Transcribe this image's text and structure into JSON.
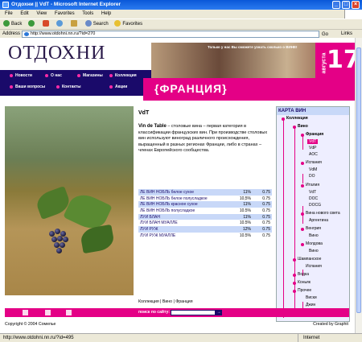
{
  "window": {
    "title": "Отдохни || VdT - Microsoft Internet Explorer"
  },
  "menu": [
    "File",
    "Edit",
    "View",
    "Favorites",
    "Tools",
    "Help"
  ],
  "toolbar": {
    "back": "Back",
    "search": "Search",
    "favorites": "Favorites"
  },
  "address": {
    "label": "Address",
    "url": "http://www.otdohni.nn.ru/?id=270",
    "go": "Go",
    "links": "Links"
  },
  "site": {
    "logo": "ОТДОХНИ",
    "banner_text": "Только у нас Вы сможете узнать сколько о ВИНЕ!",
    "date_day": "17",
    "date_month": "августа",
    "nav": [
      "Новости",
      "О нас",
      "Магазины",
      "Коллекция",
      "Ваши вопросы",
      "Контакты",
      "Акции"
    ],
    "section_title": "{ФРАНЦИЯ}"
  },
  "article": {
    "heading": "VdT",
    "lead_bold": "Vin de Table",
    "text": " – столовые вина – первая категория в классификации французских вин. При производстве столовых вин используют виноград различного происхождения, выращенный в разных регионах Франции, либо в странах – членах Европейского сообщества."
  },
  "wines": [
    {
      "name": "ЛЕ ВИН НОБЛЬ белое сухое",
      "pct": "11%",
      "vol": "0.75"
    },
    {
      "name": "ЛЕ ВИН НОБЛЬ белое полусладкое",
      "pct": "10,5%",
      "vol": "0.75"
    },
    {
      "name": "ЛЕ ВИН НОБЛЬ красное сухое",
      "pct": "11%",
      "vol": "0.75"
    },
    {
      "name": "ЛЕ ВИН НОБЛЬ полусладкое",
      "pct": "10.5%",
      "vol": "0.75"
    },
    {
      "name": "ЛУИ БЛАН",
      "pct": "11%",
      "vol": "0.75"
    },
    {
      "name": "ЛУИ БЛАН МУАЛЛЕ",
      "pct": "10.5%",
      "vol": "0.75"
    },
    {
      "name": "ЛУИ РУЖ",
      "pct": "12%",
      "vol": "0.75"
    },
    {
      "name": "ЛУИ РУЖ МУАЛЛЕ",
      "pct": "10.5%",
      "vol": "0.75"
    }
  ],
  "breadcrumb": "Коллекция | Вино | Франция",
  "map": {
    "title": "КАРТА ВИН",
    "nodes": [
      "Коллекция",
      "Вино",
      "Франция",
      "VdT",
      "VdP",
      "AOC",
      "Испания",
      "VdM",
      "DO",
      "Италия",
      "VdT",
      "DOC",
      "DOCG",
      "Вина нового света",
      "Аргентина",
      "Венгрия",
      "Вино",
      "Молдова",
      "Вино",
      "Шампанское",
      "Испания",
      "Водка",
      "Коньяк",
      "Прочее",
      "Виски",
      "Джин"
    ]
  },
  "footer": {
    "search_label": "поиск по сайту:",
    "go": "→"
  },
  "copyright": "Copyright © 2004 Сомелье",
  "created": "Created by Graphit",
  "status": {
    "url": "http://www.otdohni.nn.ru/?id=495",
    "zone": "Internet"
  }
}
